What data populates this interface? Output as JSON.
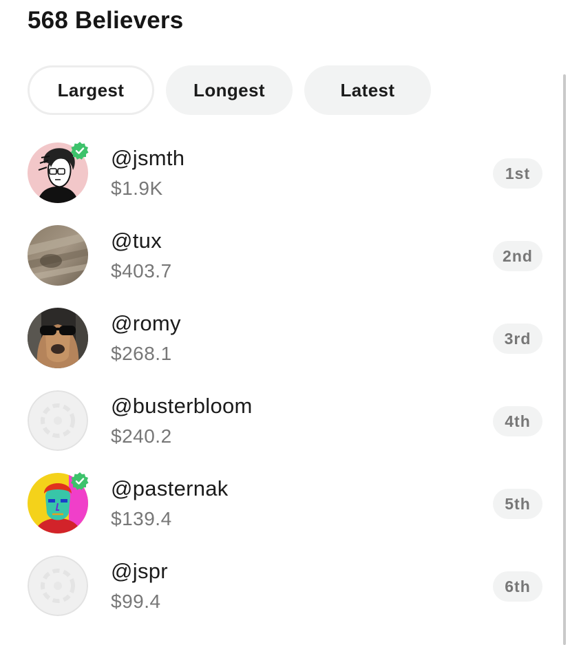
{
  "header": {
    "title": "568 Believers"
  },
  "tabs": [
    {
      "label": "Largest",
      "active": true
    },
    {
      "label": "Longest",
      "active": false
    },
    {
      "label": "Latest",
      "active": false
    }
  ],
  "believers": [
    {
      "handle": "@jsmth",
      "amount": "$1.9K",
      "rank": "1st",
      "verified": true,
      "avatar": "illustrated-portrait"
    },
    {
      "handle": "@tux",
      "amount": "$403.7",
      "rank": "2nd",
      "verified": false,
      "avatar": "blurred-photo"
    },
    {
      "handle": "@romy",
      "amount": "$268.1",
      "rank": "3rd",
      "verified": false,
      "avatar": "dog-sunglasses-photo"
    },
    {
      "handle": "@busterbloom",
      "amount": "$240.2",
      "rank": "4th",
      "verified": false,
      "avatar": "default-placeholder"
    },
    {
      "handle": "@pasternak",
      "amount": "$139.4",
      "rank": "5th",
      "verified": true,
      "avatar": "colorful-portrait"
    },
    {
      "handle": "@jspr",
      "amount": "$99.4",
      "rank": "6th",
      "verified": false,
      "avatar": "default-placeholder"
    }
  ],
  "colors": {
    "verified": "#3dc26b",
    "pill_bg": "#f2f3f3",
    "muted_text": "#777777"
  }
}
